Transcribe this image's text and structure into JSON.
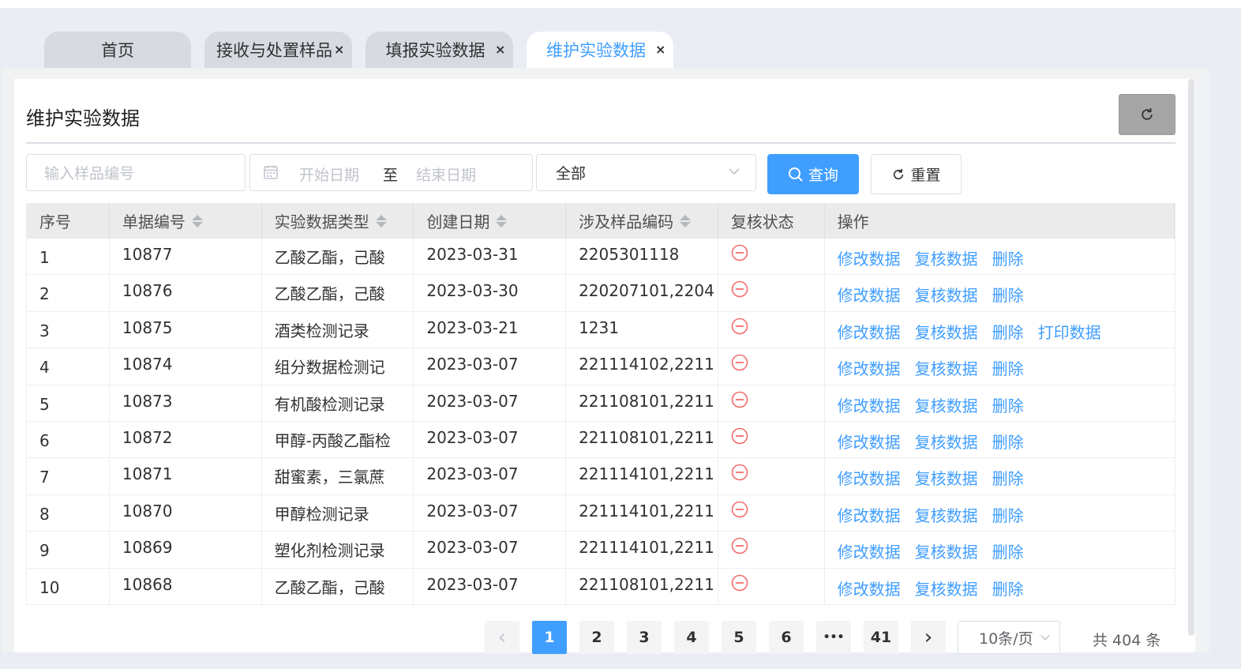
{
  "tabs": [
    {
      "label": "首页",
      "closable": false,
      "active": false
    },
    {
      "label": "接收与处置样品",
      "closable": true,
      "active": false
    },
    {
      "label": "填报实验数据",
      "closable": true,
      "active": false
    },
    {
      "label": "维护实验数据",
      "closable": true,
      "active": true
    }
  ],
  "tab_close_glyph": "×",
  "page": {
    "title": "维护实验数据",
    "refresh_icon": "refresh-icon"
  },
  "filters": {
    "sample_placeholder": "输入样品编号",
    "start_placeholder": "开始日期",
    "range_separator": "至",
    "end_placeholder": "结束日期",
    "status_value": "全部",
    "search_label": "查询",
    "reset_label": "重置"
  },
  "table": {
    "columns": [
      "序号",
      "单据编号",
      "实验数据类型",
      "创建日期",
      "涉及样品编码",
      "复核状态",
      "操作"
    ],
    "rows": [
      {
        "index": "1",
        "doc_no": "10877",
        "type": "乙酸乙酯，己酸",
        "date": "2023-03-31",
        "samples": "2205301118",
        "ops": [
          "修改数据",
          "复核数据",
          "删除"
        ]
      },
      {
        "index": "2",
        "doc_no": "10876",
        "type": "乙酸乙酯，己酸",
        "date": "2023-03-30",
        "samples": "220207101,2204",
        "ops": [
          "修改数据",
          "复核数据",
          "删除"
        ]
      },
      {
        "index": "3",
        "doc_no": "10875",
        "type": "酒类检测记录",
        "date": "2023-03-21",
        "samples": "1231",
        "ops": [
          "修改数据",
          "复核数据",
          "删除",
          "打印数据"
        ]
      },
      {
        "index": "4",
        "doc_no": "10874",
        "type": "组分数据检测记",
        "date": "2023-03-07",
        "samples": "221114102,2211",
        "ops": [
          "修改数据",
          "复核数据",
          "删除"
        ]
      },
      {
        "index": "5",
        "doc_no": "10873",
        "type": "有机酸检测记录",
        "date": "2023-03-07",
        "samples": "221108101,2211",
        "ops": [
          "修改数据",
          "复核数据",
          "删除"
        ]
      },
      {
        "index": "6",
        "doc_no": "10872",
        "type": "甲醇-丙酸乙酯检",
        "date": "2023-03-07",
        "samples": "221108101,2211",
        "ops": [
          "修改数据",
          "复核数据",
          "删除"
        ]
      },
      {
        "index": "7",
        "doc_no": "10871",
        "type": "甜蜜素，三氯蔗",
        "date": "2023-03-07",
        "samples": "221114101,2211",
        "ops": [
          "修改数据",
          "复核数据",
          "删除"
        ]
      },
      {
        "index": "8",
        "doc_no": "10870",
        "type": "甲醇检测记录",
        "date": "2023-03-07",
        "samples": "221114101,2211",
        "ops": [
          "修改数据",
          "复核数据",
          "删除"
        ]
      },
      {
        "index": "9",
        "doc_no": "10869",
        "type": "塑化剂检测记录",
        "date": "2023-03-07",
        "samples": "221114101,2211",
        "ops": [
          "修改数据",
          "复核数据",
          "删除"
        ]
      },
      {
        "index": "10",
        "doc_no": "10868",
        "type": "乙酸乙酯，己酸",
        "date": "2023-03-07",
        "samples": "221108101,2211",
        "ops": [
          "修改数据",
          "复核数据",
          "删除"
        ]
      }
    ],
    "status_icon": "minus-circle-icon",
    "status_color": "#f56c6c"
  },
  "pagination": {
    "prev": "‹",
    "pages": [
      "1",
      "2",
      "3",
      "4",
      "5",
      "6",
      "•••",
      "41"
    ],
    "current": "1",
    "next": "›",
    "page_size": "10条/页",
    "total_text": "共 404 条"
  },
  "colors": {
    "accent": "#409eff",
    "danger": "#f56c6c"
  }
}
